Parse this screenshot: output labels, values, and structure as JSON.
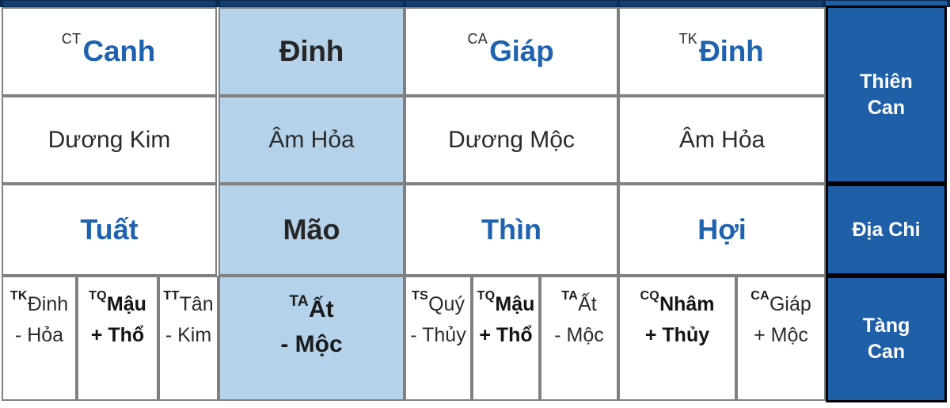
{
  "columns": [
    {
      "stem": {
        "sup": "CT",
        "name": "Canh"
      },
      "element": "Dương Kim",
      "branch": "Tuất",
      "highlight": false,
      "hidden_stems": [
        {
          "sup": "TK",
          "name": "Đinh",
          "element": "- Hỏa",
          "strong": false
        },
        {
          "sup": "TQ",
          "name": "Mậu",
          "element": "+ Thổ",
          "strong": true
        },
        {
          "sup": "TT",
          "name": "Tân",
          "element": "- Kim",
          "strong": false
        }
      ]
    },
    {
      "stem": {
        "sup": "",
        "name": "Đinh"
      },
      "element": "Âm Hỏa",
      "branch": "Mão",
      "highlight": true,
      "hidden_stems": [
        {
          "sup": "TA",
          "name": "Ất",
          "element": "- Mộc",
          "strong": true
        }
      ]
    },
    {
      "stem": {
        "sup": "CA",
        "name": "Giáp"
      },
      "element": "Dương Mộc",
      "branch": "Thìn",
      "highlight": false,
      "hidden_stems": [
        {
          "sup": "TS",
          "name": "Quý",
          "element": "- Thủy",
          "strong": false
        },
        {
          "sup": "TQ",
          "name": "Mậu",
          "element": "+ Thổ",
          "strong": true
        },
        {
          "sup": "TA",
          "name": "Ất",
          "element": "- Mộc",
          "strong": false
        }
      ]
    },
    {
      "stem": {
        "sup": "TK",
        "name": "Đinh"
      },
      "element": "Âm Hỏa",
      "branch": "Hợi",
      "highlight": false,
      "hidden_stems": [
        {
          "sup": "CQ",
          "name": "Nhâm",
          "element": "+ Thủy",
          "strong": true
        },
        {
          "sup": "CA",
          "name": "Giáp",
          "element": "+ Mộc",
          "strong": false
        }
      ]
    }
  ],
  "row_labels": {
    "thien_can_line1": "Thiên",
    "thien_can_line2": "Can",
    "dia_chi": "Địa Chi",
    "tang_can_line1": "Tàng",
    "tang_can_line2": "Can"
  },
  "colors": {
    "label_bg": "#1f5fa8",
    "highlight_bg": "#b4d2ea",
    "stem_blue": "#1f63b0",
    "border": "#808080",
    "top_strip": "#0c2a52"
  }
}
